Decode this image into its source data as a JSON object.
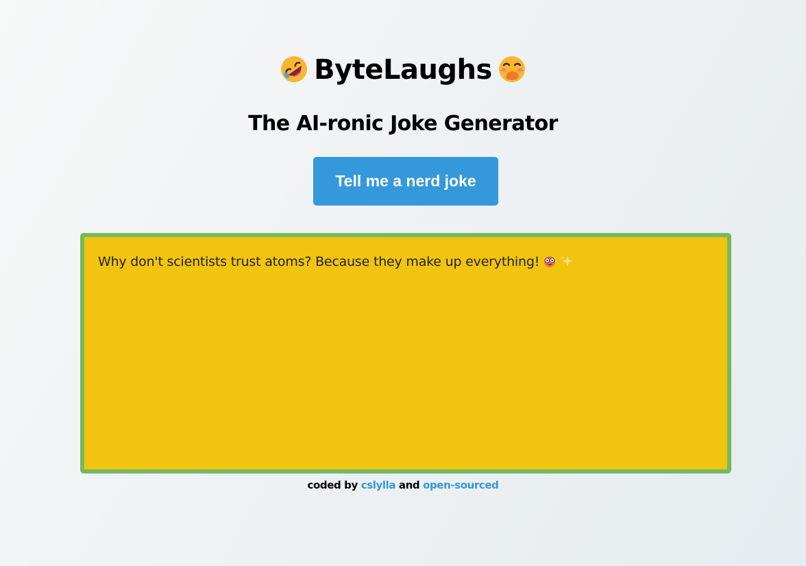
{
  "header": {
    "title": "ByteLaughs",
    "left_icon": "rolling-on-floor-laughing-icon",
    "right_icon": "face-with-hand-over-mouth-icon",
    "subtitle": "The AI-ronic Joke Generator"
  },
  "button": {
    "label": "Tell me a nerd joke"
  },
  "joke": {
    "text": "Why don't scientists trust atoms? Because they make up everything!",
    "icons": [
      "nerd-face-icon",
      "sparkles-icon"
    ]
  },
  "footer": {
    "prefix": "coded by",
    "author_link": "cslylla",
    "conjunction": "and",
    "source_link": "open-sourced"
  },
  "colors": {
    "button": "#3498db",
    "joke_box": "#f1c40f",
    "joke_border": "#74b95f",
    "link": "#3498db"
  }
}
